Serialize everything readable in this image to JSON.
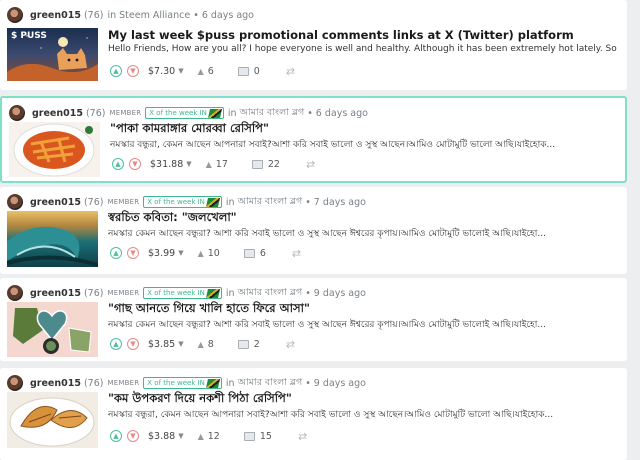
{
  "posts": [
    {
      "author": "green015",
      "reputation": "(76)",
      "member": "",
      "badge": "",
      "in_label": "in",
      "community": "Steem Alliance",
      "age": "6 days ago",
      "title": "My last week $puss promotional comments links at X (Twitter) platform",
      "body": "Hello Friends, How are you all? I hope everyone is well and healthy. Although it has been extremely hot lately. So I...",
      "thumb_label": "$ PUSS",
      "payout": "$7.30",
      "votes": "6",
      "comments": "0"
    },
    {
      "author": "green015",
      "reputation": "(76)",
      "member": "MEMBER",
      "badge": "X of the week IN",
      "in_label": "in",
      "community": "আমার বাংলা ব্লগ",
      "age": "6 days ago",
      "title": "\"পাকা কামরাঙ্গার মোরব্বা রেসিপি\"",
      "body": "নমস্কার বন্ধুরা, কেমন আছেন আপনারা সবাই?আশা করি সবাই ভালো ও সুস্থ আছেন।আমিও মোটামুটি ভালো আছি।যাইহোক...",
      "payout": "$31.88",
      "votes": "17",
      "comments": "22"
    },
    {
      "author": "green015",
      "reputation": "(76)",
      "member": "MEMBER",
      "badge": "X of the week IN",
      "in_label": "in",
      "community": "আমার বাংলা ব্লগ",
      "age": "7 days ago",
      "title": "স্বরচিত কবিতা: \"জলখেলা\"",
      "body": "নমস্কার কেমন আছেন বন্ধুরা? আশা করি সবাই ভালো ও সুস্থ আছেন ঈশ্বরের কৃপায়।আমিও মোটামুটি ভালোই আছি।যাইহো...",
      "payout": "$3.99",
      "votes": "10",
      "comments": "6"
    },
    {
      "author": "green015",
      "reputation": "(76)",
      "member": "MEMBER",
      "badge": "X of the week IN",
      "in_label": "in",
      "community": "আমার বাংলা ব্লগ",
      "age": "9 days ago",
      "title": "\"গাছ আনতে গিয়ে খালি হাতে ফিরে আসা\"",
      "body": "নমস্কার কেমন আছেন বন্ধুরা? আশা করি সবাই ভালো ও সুস্থ আছেন ঈশ্বরের কৃপায়।আমিও মোটামুটি ভালোই আছি।যাইহো...",
      "payout": "$3.85",
      "votes": "8",
      "comments": "2"
    },
    {
      "author": "green015",
      "reputation": "(76)",
      "member": "MEMBER",
      "badge": "X of the week IN",
      "in_label": "in",
      "community": "আমার বাংলা ব্লগ",
      "age": "9 days ago",
      "title": "\"কম উপকরণ দিয়ে নকশী পিঠা রেসিপি\"",
      "body": "নমস্কার বন্ধুরা, কেমন আছেন আপনারা সবাই?আশা করি সবাই ভালো ও সুস্থ আছেন।আমিও মোটামুটি ভালো আছি।যাইহোক...",
      "payout": "$3.88",
      "votes": "12",
      "comments": "15"
    }
  ],
  "colors": {
    "upvote": "#4fbf9f",
    "downvote": "#e58a8a",
    "badge": "#3fb98b",
    "highlight_border": "#7fe0c8"
  },
  "icons": {
    "upvote": "chevron-up-icon",
    "downvote": "chevron-down-icon",
    "votes": "chevron-up-small-icon",
    "comments": "comment-icon",
    "reblog": "reblog-icon"
  }
}
